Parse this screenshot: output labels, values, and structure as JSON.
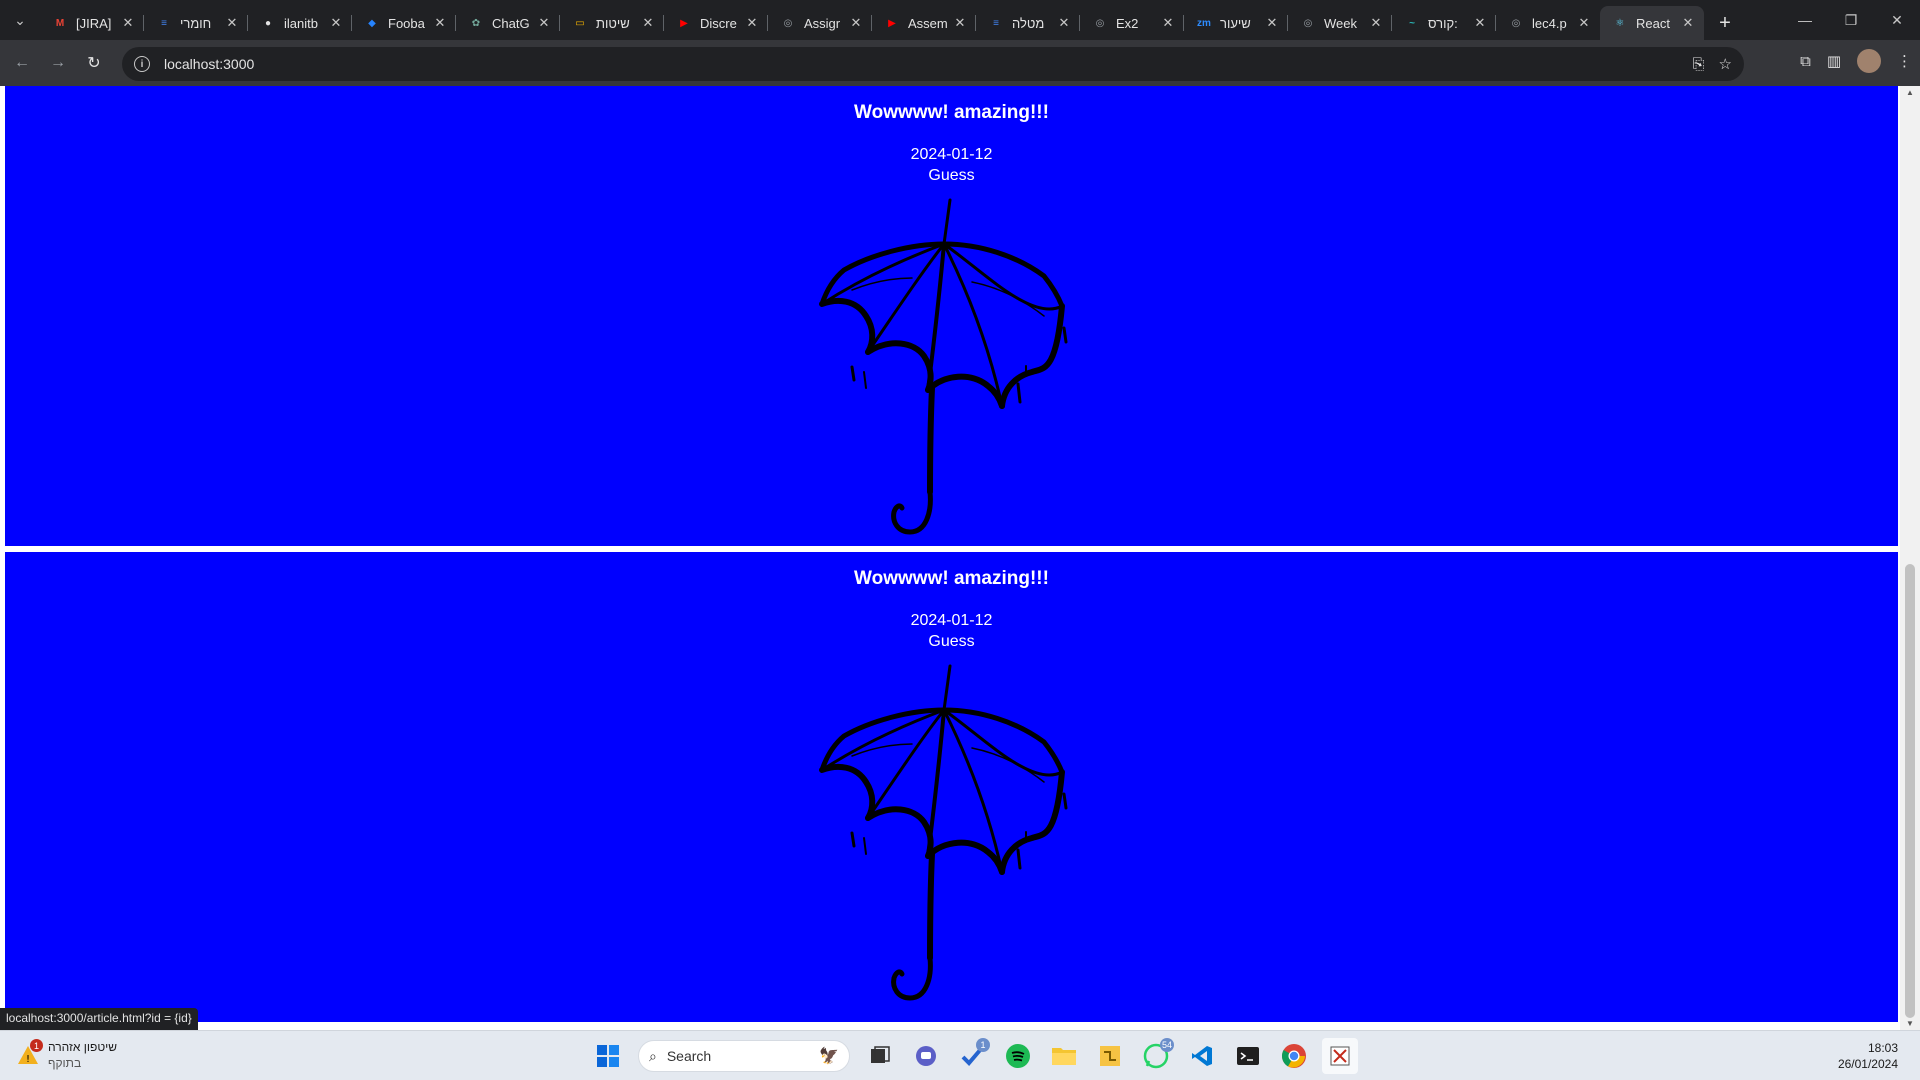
{
  "browser": {
    "tabs": [
      {
        "title": "[JIRA]",
        "icon": "gmail-icon",
        "color": "#ea4335",
        "glyph": "M"
      },
      {
        "title": "חומרי",
        "icon": "docs-icon",
        "color": "#4285f4",
        "glyph": "≡"
      },
      {
        "title": "ilanitb",
        "icon": "github-icon",
        "color": "#e3e3e3",
        "glyph": "●"
      },
      {
        "title": "Fooba",
        "icon": "jira-icon",
        "color": "#2684ff",
        "glyph": "◆"
      },
      {
        "title": "ChatG",
        "icon": "chatgpt-icon",
        "color": "#74aa9c",
        "glyph": "✿"
      },
      {
        "title": "שיטות",
        "icon": "slides-icon",
        "color": "#f4b400",
        "glyph": "▭"
      },
      {
        "title": "Discre",
        "icon": "youtube-icon",
        "color": "#ff0000",
        "glyph": "▶"
      },
      {
        "title": "Assigr",
        "icon": "globe-icon",
        "color": "#9aa0a6",
        "glyph": "◎"
      },
      {
        "title": "Assem",
        "icon": "youtube-icon",
        "color": "#ff0000",
        "glyph": "▶"
      },
      {
        "title": "מטלה",
        "icon": "docs-icon",
        "color": "#4285f4",
        "glyph": "≡"
      },
      {
        "title": "Ex2",
        "icon": "globe-icon",
        "color": "#9aa0a6",
        "glyph": "◎"
      },
      {
        "title": "שיעור",
        "icon": "zoom-icon",
        "color": "#2d8cff",
        "glyph": "zm"
      },
      {
        "title": "Week",
        "icon": "globe-icon",
        "color": "#9aa0a6",
        "glyph": "◎"
      },
      {
        "title": "קורס:",
        "icon": "moodle-icon",
        "color": "#2ab4b4",
        "glyph": "~"
      },
      {
        "title": "lec4.p",
        "icon": "globe-icon",
        "color": "#9aa0a6",
        "glyph": "◎"
      },
      {
        "title": "React",
        "icon": "react-icon",
        "color": "#61dafb",
        "glyph": "⚛",
        "active": true
      }
    ],
    "url": "localhost:3000",
    "status_url": "localhost:3000/article.html?id = {id}"
  },
  "articles": [
    {
      "title": "Wowwww! amazing!!!",
      "date": "2024-01-12",
      "author": "Guess"
    },
    {
      "title": "Wowwww! amazing!!!",
      "date": "2024-01-12",
      "author": "Guess"
    }
  ],
  "taskbar": {
    "weather_title": "שיטפון אזהרה",
    "weather_sub": "בתוקף",
    "weather_badge": "1",
    "search_placeholder": "Search",
    "todo_badge": "1",
    "whatsapp_badge": "54",
    "time": "18:03",
    "date": "26/01/2024"
  },
  "colors": {
    "article_bg": "#0000ff",
    "chrome_dark": "#202124",
    "chrome_toolbar": "#35363a"
  }
}
